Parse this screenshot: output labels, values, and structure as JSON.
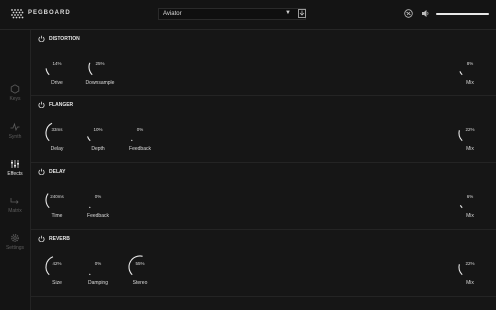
{
  "app": {
    "brand": "PEGBOARD"
  },
  "header": {
    "preset_value": "Aviator",
    "volume_level": 1.0
  },
  "sidebar": {
    "items": [
      {
        "label": "Keys",
        "icon": "hexagon-icon"
      },
      {
        "label": "Synth",
        "icon": "waveform-icon"
      },
      {
        "label": "Effects",
        "icon": "sliders-icon"
      },
      {
        "label": "Matrix",
        "icon": "routing-icon"
      },
      {
        "label": "Settings",
        "icon": "gear-icon"
      }
    ],
    "active": "Effects"
  },
  "sections": {
    "distortion": {
      "title": "DISTORTION",
      "knobs": [
        {
          "label": "Drive",
          "value": "14%",
          "amount": 0.14
        },
        {
          "label": "Downsample",
          "value": "25%",
          "amount": 0.25
        },
        {
          "label": "Mix",
          "value": "8%",
          "amount": 0.08
        }
      ]
    },
    "flanger": {
      "title": "FLANGER",
      "knobs": [
        {
          "label": "Delay",
          "value": "33ms",
          "amount": 0.4
        },
        {
          "label": "Depth",
          "value": "10%",
          "amount": 0.1
        },
        {
          "label": "Feedback",
          "value": "0%",
          "amount": 0.0
        },
        {
          "label": "Mix",
          "value": "22%",
          "amount": 0.22
        }
      ]
    },
    "delay": {
      "title": "DELAY",
      "knobs": [
        {
          "label": "Time",
          "value": "240ms",
          "amount": 0.3
        },
        {
          "label": "Feedback",
          "value": "0%",
          "amount": 0.0
        },
        {
          "label": "Mix",
          "value": "6%",
          "amount": 0.06
        }
      ]
    },
    "reverb": {
      "title": "REVERB",
      "knobs": [
        {
          "label": "Size",
          "value": "42%",
          "amount": 0.42
        },
        {
          "label": "Damping",
          "value": "0%",
          "amount": 0.0
        },
        {
          "label": "Stereo",
          "value": "55%",
          "amount": 0.55
        },
        {
          "label": "Mix",
          "value": "22%",
          "amount": 0.22
        }
      ]
    }
  },
  "colors": {
    "background": "#161616",
    "arc": "#e8e8e8",
    "inactive": "#5d5d5d"
  }
}
